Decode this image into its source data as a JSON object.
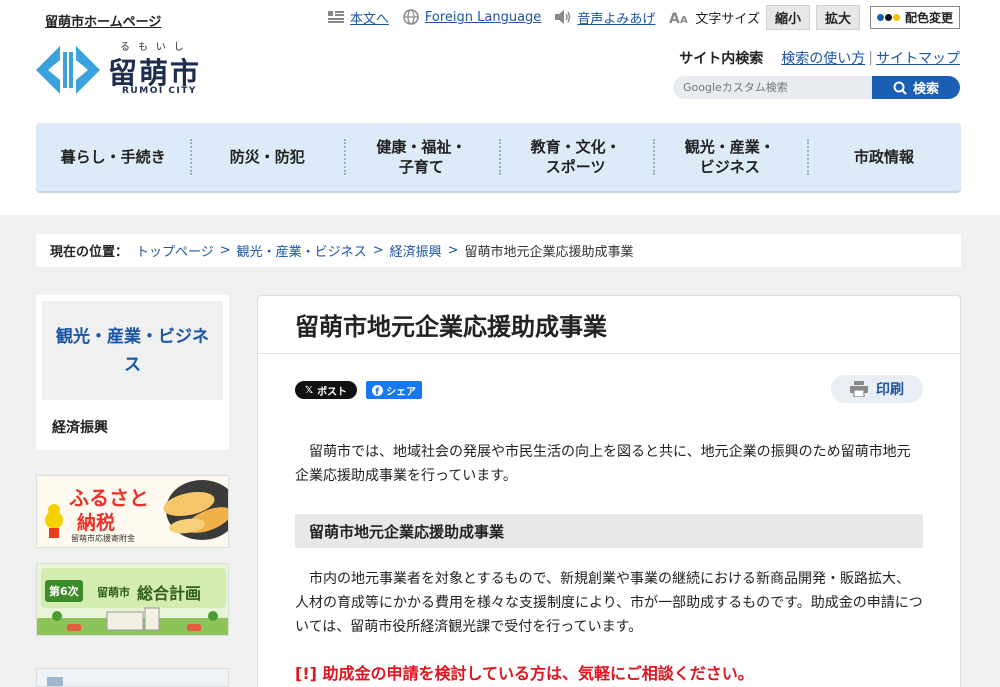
{
  "header": {
    "home_link": "留萌市ホームページ",
    "logo": {
      "ruby": "るもいし",
      "name": "留萌市",
      "en": "RUMOI CITY"
    },
    "util": {
      "honbun": "本文へ",
      "foreign": "Foreign Language",
      "voice": "音声よみあげ",
      "fontsize_label": "文字サイズ",
      "shrink": "縮小",
      "enlarge": "拡大",
      "color_change": "配色変更"
    },
    "search": {
      "title": "サイト内検索",
      "howto": "検索の使い方",
      "sitemap": "サイトマップ",
      "placeholder": "Googleカスタム検索",
      "button": "検索"
    }
  },
  "gnav": [
    "暮らし・手続き",
    "防災・防犯",
    "健康・福祉・\n子育て",
    "教育・文化・\nスポーツ",
    "観光・産業・\nビジネス",
    "市政情報"
  ],
  "breadcrumb": {
    "label": "現在の位置：",
    "items": [
      "トップページ",
      "観光・産業・ビジネス",
      "経済振興"
    ],
    "current": "留萌市地元企業応援助成事業",
    "separator": ">"
  },
  "sidebar": {
    "title": "観光・産業・ビジネス",
    "sub": "経済振興",
    "banner1": {
      "line1": "ふるさと",
      "line2": "納税",
      "caption": "留萌市応援寄附金"
    },
    "banner2": {
      "badge": "第6次",
      "text_small": "留萌市",
      "text_big": "総合計画"
    }
  },
  "main": {
    "title": "留萌市地元企業応援助成事業",
    "x_post": "ポスト",
    "fb_share": "シェア",
    "print": "印刷",
    "para1": "留萌市では、地域社会の発展や市民生活の向上を図ると共に、地元企業の振興のため留萌市地元企業応援助成事業を行っています。",
    "heading": "留萌市地元企業応援助成事業",
    "para2": "市内の地元事業者を対象とするもので、新規創業や事業の継続における新商品開発・販路拡大、人材の育成等にかかる費用を様々な支援制度により、市が一部助成するものです。助成金の申請については、留萌市役所経済観光課で受付を行っています。",
    "notice": "[!] 助成金の申請を検討している方は、気軽にご相談ください。"
  },
  "colors": {
    "brand_blue": "#1a5fb4",
    "link_blue": "#1a55a8",
    "nav_bg": "#dcebf7",
    "alert_red": "#e0141e",
    "logo_cyan": "#3aa3dd"
  }
}
